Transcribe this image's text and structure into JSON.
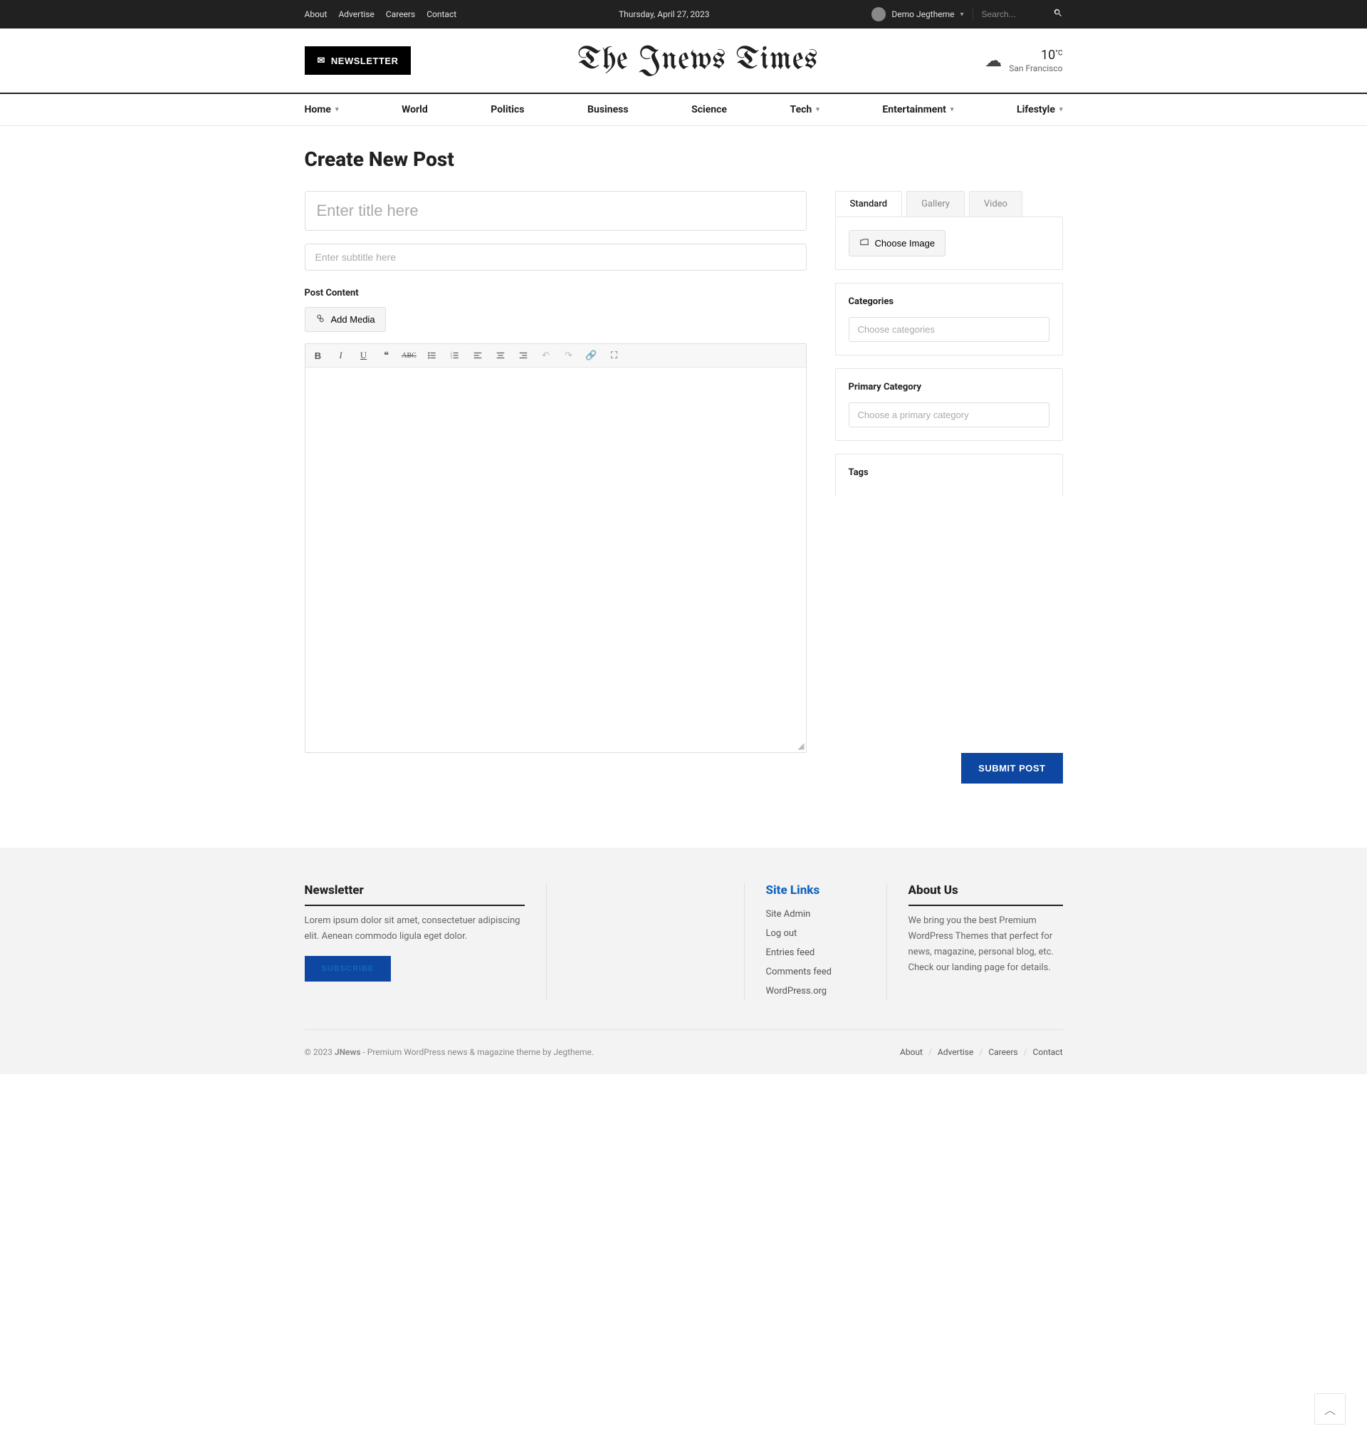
{
  "topbar": {
    "links": [
      "About",
      "Advertise",
      "Careers",
      "Contact"
    ],
    "date": "Thursday, April 27, 2023",
    "user": "Demo Jegtheme",
    "search_placeholder": "Search..."
  },
  "header": {
    "newsletter": "NEWSLETTER",
    "logo": "The Jnews Times",
    "weather": {
      "temp": "10",
      "unit": "°C",
      "location": "San Francisco"
    }
  },
  "nav": {
    "items": [
      {
        "label": "Home",
        "dropdown": true
      },
      {
        "label": "World",
        "dropdown": false
      },
      {
        "label": "Politics",
        "dropdown": false
      },
      {
        "label": "Business",
        "dropdown": false
      },
      {
        "label": "Science",
        "dropdown": false
      },
      {
        "label": "Tech",
        "dropdown": true
      },
      {
        "label": "Entertainment",
        "dropdown": true
      },
      {
        "label": "Lifestyle",
        "dropdown": true
      }
    ]
  },
  "page": {
    "title": "Create New Post",
    "title_placeholder": "Enter title here",
    "subtitle_placeholder": "Enter subtitle here",
    "content_label": "Post Content",
    "add_media": "Add Media",
    "submit": "SUBMIT POST"
  },
  "sidebar": {
    "tabs": [
      "Standard",
      "Gallery",
      "Video"
    ],
    "choose_image": "Choose Image",
    "categories": {
      "label": "Categories",
      "placeholder": "Choose categories"
    },
    "primary": {
      "label": "Primary Category",
      "placeholder": "Choose a primary category"
    },
    "tags": {
      "label": "Tags"
    }
  },
  "footer": {
    "newsletter": {
      "heading": "Newsletter",
      "text": "Lorem ipsum dolor sit amet, consectetuer adipiscing elit. Aenean commodo ligula eget dolor.",
      "button": "SUBSCRIBE"
    },
    "sitelinks": {
      "heading": "Site Links",
      "items": [
        "Site Admin",
        "Log out",
        "Entries feed",
        "Comments feed",
        "WordPress.org"
      ]
    },
    "about": {
      "heading": "About Us",
      "text": "We bring you the best Premium WordPress Themes that perfect for news, magazine, personal blog, etc. Check our landing page for details."
    },
    "bottom": {
      "copyright_prefix": "© 2023 ",
      "brand": "JNews",
      "copyright_suffix": " - Premium WordPress news & magazine theme by ",
      "vendor": "Jegtheme",
      "links": [
        "About",
        "Advertise",
        "Careers",
        "Contact"
      ]
    }
  }
}
